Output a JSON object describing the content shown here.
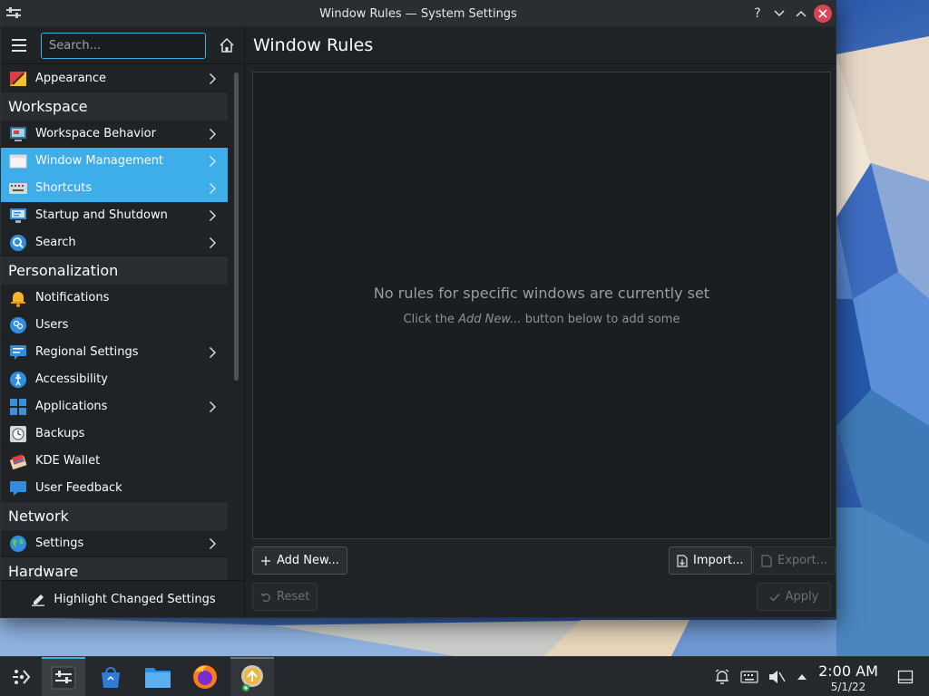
{
  "window": {
    "title": "Window Rules — System Settings",
    "controls": [
      "?",
      "⌄",
      "⌃",
      "✕"
    ]
  },
  "sidebar": {
    "search_placeholder": "Search...",
    "items": [
      {
        "type": "item",
        "label": "Appearance",
        "icon": "appearance-icon",
        "chevron": true,
        "selected": false
      },
      {
        "type": "section",
        "label": "Workspace"
      },
      {
        "type": "item",
        "label": "Workspace Behavior",
        "icon": "workspace-behavior-icon",
        "chevron": true,
        "selected": false
      },
      {
        "type": "item",
        "label": "Window Management",
        "icon": "window-management-icon",
        "chevron": true,
        "selected": true
      },
      {
        "type": "item",
        "label": "Shortcuts",
        "icon": "keyboard-icon",
        "chevron": true,
        "selected": true
      },
      {
        "type": "item",
        "label": "Startup and Shutdown",
        "icon": "startup-icon",
        "chevron": true,
        "selected": false
      },
      {
        "type": "item",
        "label": "Search",
        "icon": "search-icon",
        "chevron": true,
        "selected": false
      },
      {
        "type": "section",
        "label": "Personalization"
      },
      {
        "type": "item",
        "label": "Notifications",
        "icon": "bell-icon",
        "chevron": false,
        "selected": false
      },
      {
        "type": "item",
        "label": "Users",
        "icon": "users-icon",
        "chevron": false,
        "selected": false
      },
      {
        "type": "item",
        "label": "Regional Settings",
        "icon": "regional-icon",
        "chevron": true,
        "selected": false
      },
      {
        "type": "item",
        "label": "Accessibility",
        "icon": "accessibility-icon",
        "chevron": false,
        "selected": false
      },
      {
        "type": "item",
        "label": "Applications",
        "icon": "applications-icon",
        "chevron": true,
        "selected": false
      },
      {
        "type": "item",
        "label": "Backups",
        "icon": "backups-icon",
        "chevron": false,
        "selected": false
      },
      {
        "type": "item",
        "label": "KDE Wallet",
        "icon": "wallet-icon",
        "chevron": false,
        "selected": false
      },
      {
        "type": "item",
        "label": "User Feedback",
        "icon": "feedback-icon",
        "chevron": false,
        "selected": false
      },
      {
        "type": "section",
        "label": "Network"
      },
      {
        "type": "item",
        "label": "Settings",
        "icon": "globe-icon",
        "chevron": true,
        "selected": false
      },
      {
        "type": "section",
        "label": "Hardware"
      }
    ],
    "footer_label": "Highlight Changed Settings"
  },
  "main": {
    "title": "Window Rules",
    "empty_title": "No rules for specific windows are currently set",
    "empty_sub_before": "Click the ",
    "empty_sub_em": "Add New...",
    "empty_sub_after": " button below to add some",
    "buttons": {
      "add_new": "Add New...",
      "import": "Import...",
      "export": "Export...",
      "reset": "Reset",
      "apply": "Apply"
    }
  },
  "taskbar": {
    "time": "2:00 AM",
    "date": "5/1/22"
  },
  "colors": {
    "accent": "#3daee9",
    "window_bg": "#202326",
    "close": "#da4453"
  }
}
